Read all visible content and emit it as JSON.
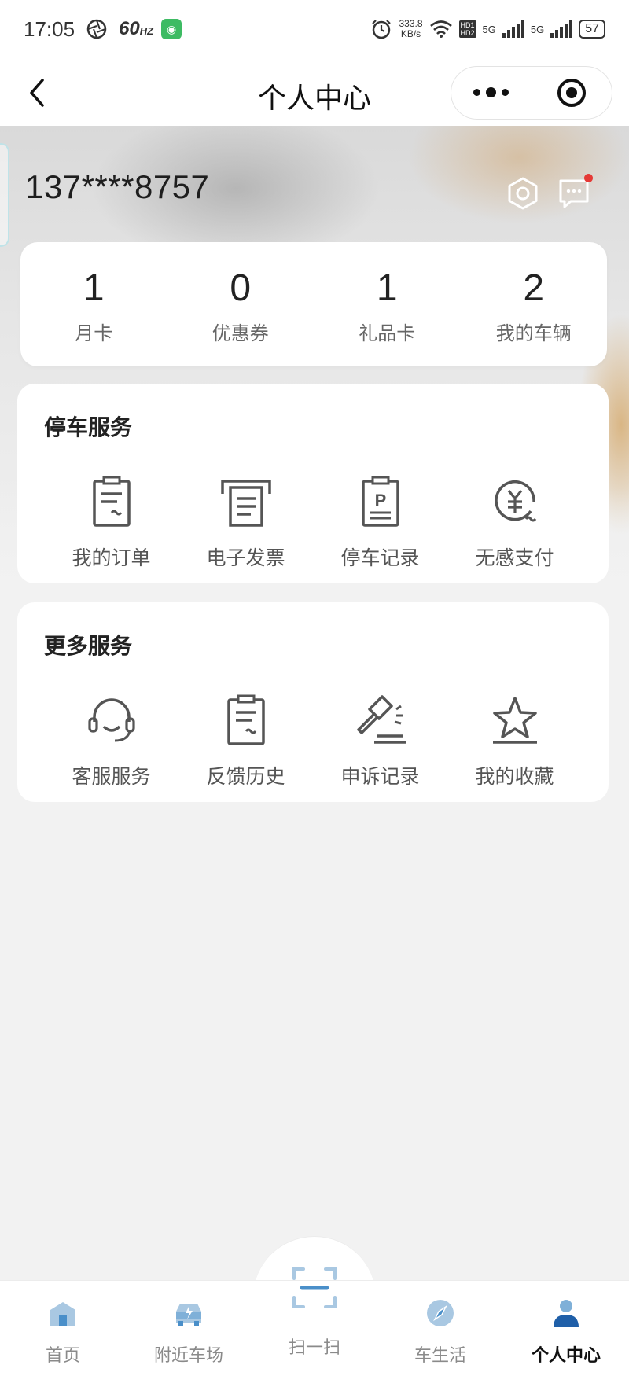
{
  "status_bar": {
    "time": "17:05",
    "refresh_rate": "60",
    "refresh_unit": "HZ",
    "net_speed_value": "333.8",
    "net_speed_unit": "KB/s",
    "hd_label_1": "HD1",
    "hd_label_2": "HD2",
    "signal_1": "5G",
    "signal_2": "5G",
    "battery": "57"
  },
  "nav": {
    "title": "个人中心"
  },
  "profile": {
    "phone": "137****8757"
  },
  "stats": [
    {
      "value": "1",
      "label": "月卡"
    },
    {
      "value": "0",
      "label": "优惠券"
    },
    {
      "value": "1",
      "label": "礼品卡"
    },
    {
      "value": "2",
      "label": "我的车辆"
    }
  ],
  "parking_services": {
    "title": "停车服务",
    "items": [
      {
        "label": "我的订单",
        "icon": "order-icon"
      },
      {
        "label": "电子发票",
        "icon": "invoice-icon"
      },
      {
        "label": "停车记录",
        "icon": "parking-record-icon"
      },
      {
        "label": "无感支付",
        "icon": "yuan-pay-icon"
      }
    ]
  },
  "more_services": {
    "title": "更多服务",
    "items": [
      {
        "label": "客服服务",
        "icon": "headset-icon"
      },
      {
        "label": "反馈历史",
        "icon": "feedback-icon"
      },
      {
        "label": "申诉记录",
        "icon": "gavel-icon"
      },
      {
        "label": "我的收藏",
        "icon": "star-icon"
      }
    ]
  },
  "tabbar": [
    {
      "label": "首页",
      "icon": "home-icon",
      "active": false
    },
    {
      "label": "附近车场",
      "icon": "car-charge-icon",
      "active": false
    },
    {
      "label": "扫一扫",
      "icon": "scan-icon",
      "active": false
    },
    {
      "label": "车生活",
      "icon": "compass-icon",
      "active": false
    },
    {
      "label": "个人中心",
      "icon": "user-icon",
      "active": true
    }
  ],
  "colors": {
    "accent_tab_icon": "#4a8fc9",
    "active_user": "#1f5fa8",
    "notification_dot": "#e53935",
    "icon_stroke": "#555555"
  }
}
